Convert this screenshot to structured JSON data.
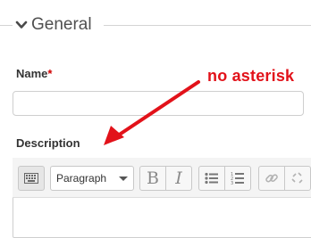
{
  "section": {
    "title": "General",
    "expanded_icon": "chevron-down-icon"
  },
  "fields": {
    "name": {
      "label": "Name",
      "required_marker": "*",
      "value": ""
    },
    "description": {
      "label": "Description"
    }
  },
  "annotation": {
    "text": "no asterisk",
    "color": "#e2121a"
  },
  "editor": {
    "toolbar": {
      "toggle_icon": "keyboard-icon",
      "format_select": "Paragraph",
      "bold": "B",
      "italic": "I",
      "unordered_list_icon": "bullet-list-icon",
      "ordered_list_icon": "numbered-list-icon",
      "link_icon": "link-icon",
      "unlink_icon": "unlink-icon"
    }
  }
}
